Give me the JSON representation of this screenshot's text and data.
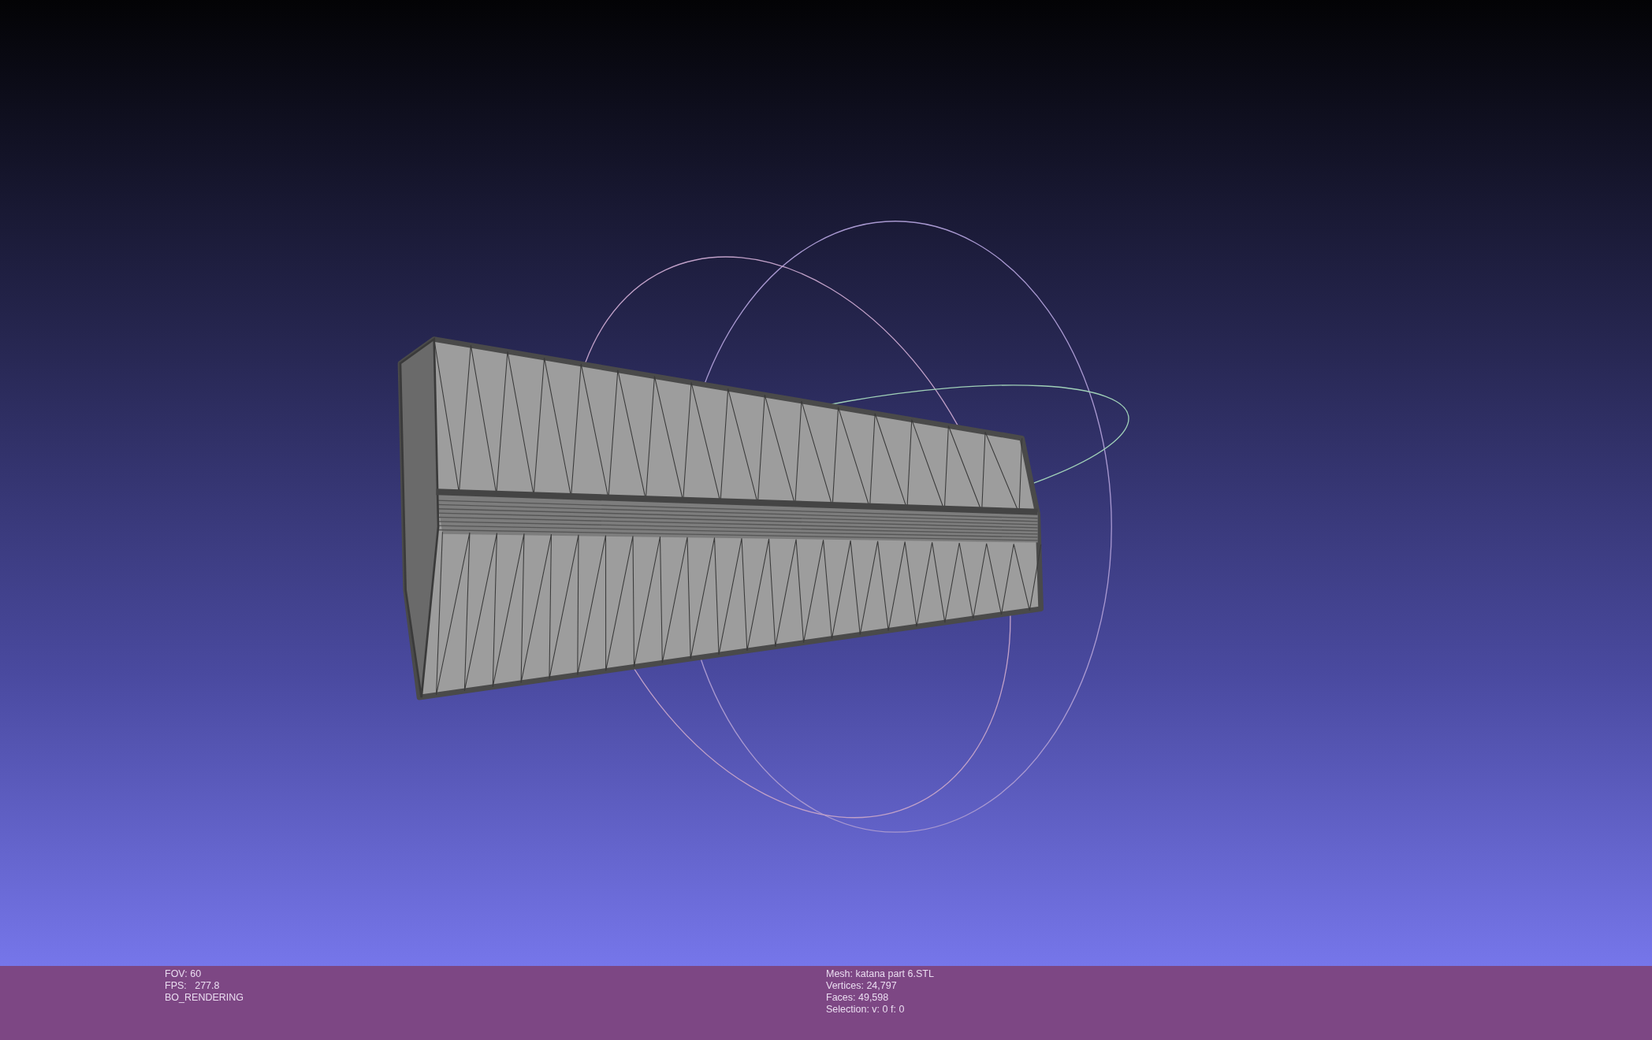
{
  "status_bar": {
    "left": [
      "FOV: 60",
      "FPS:   277.8",
      "BO_RENDERING"
    ],
    "right": [
      "Mesh: katana part 6.STL",
      "Vertices: 24,797",
      "Faces: 49,598",
      "Selection: v: 0 f: 0"
    ]
  }
}
